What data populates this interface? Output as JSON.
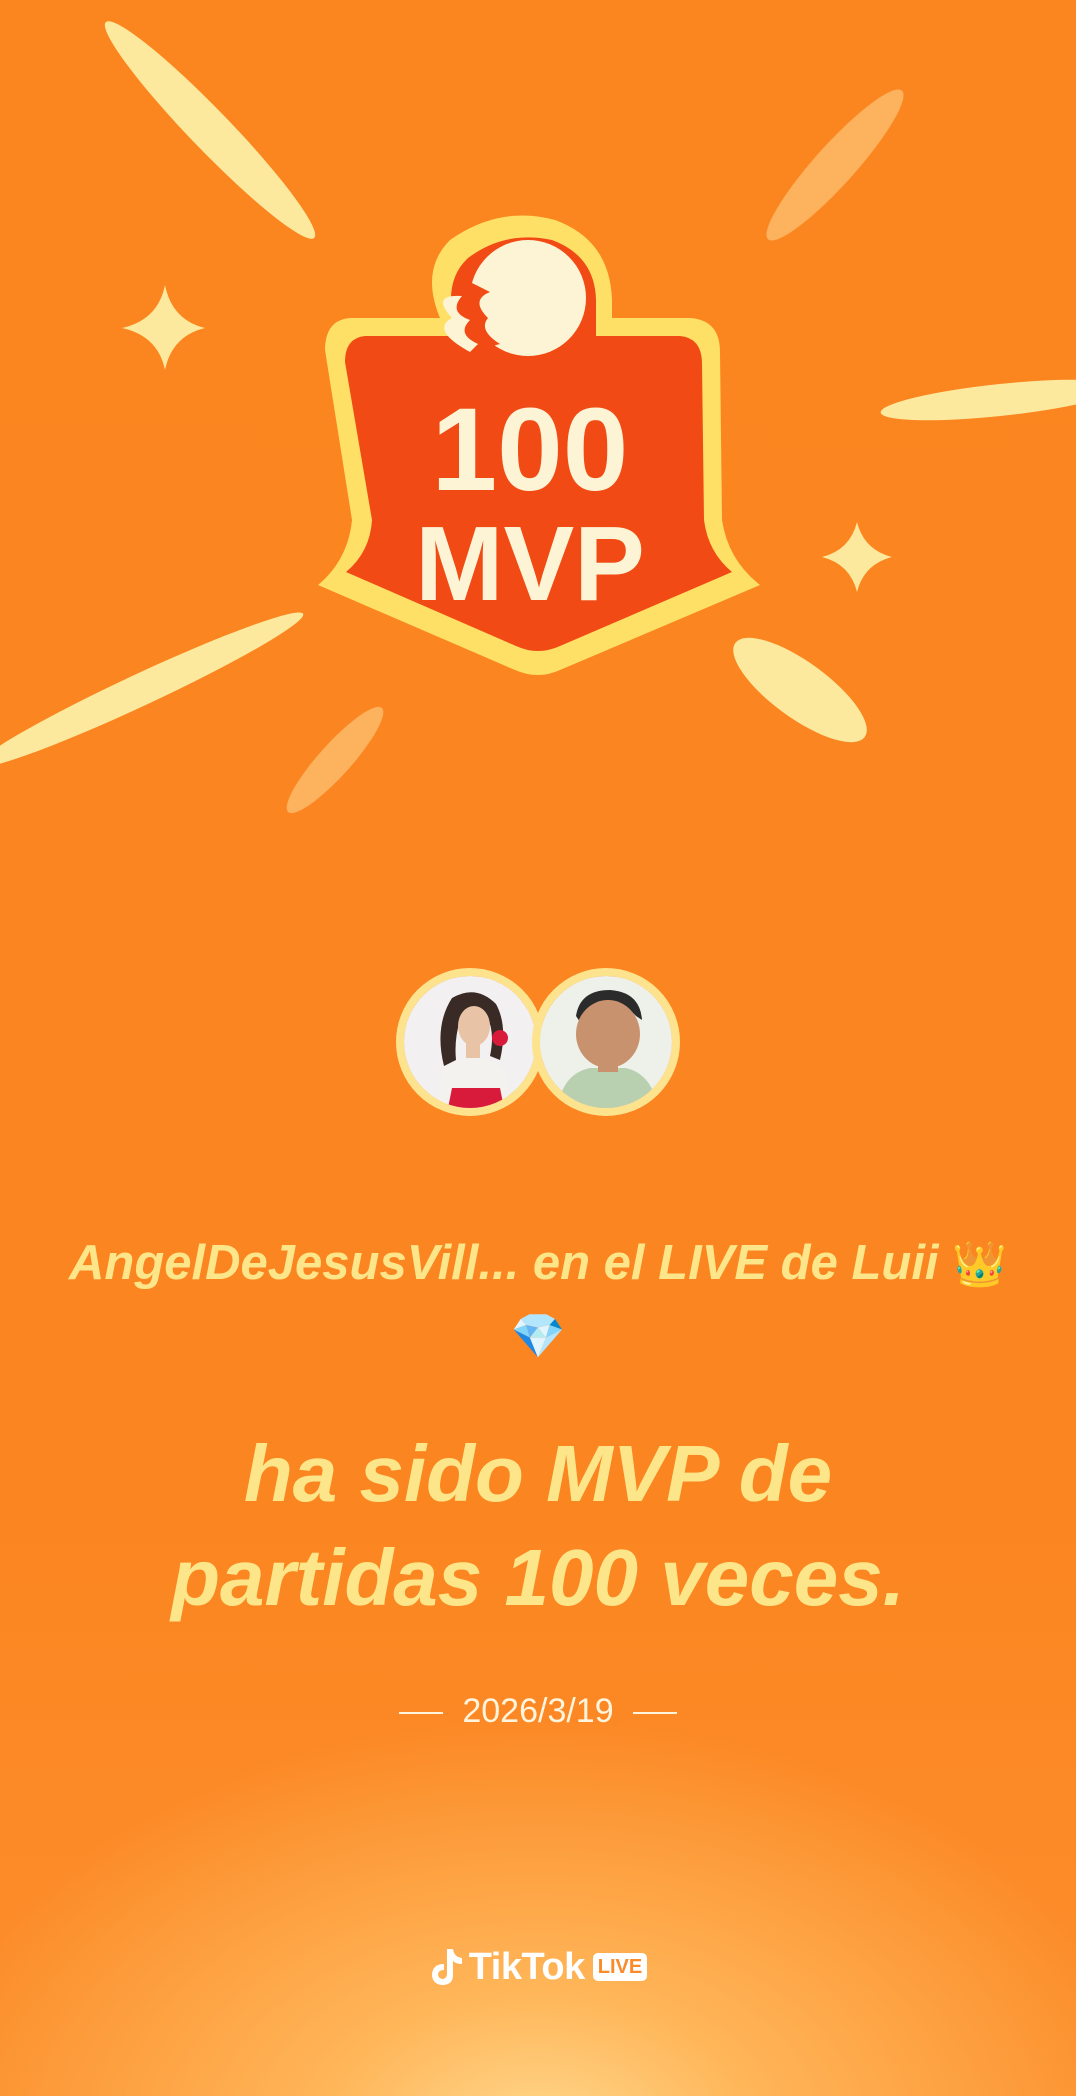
{
  "badge": {
    "line1": "100",
    "line2": "MVP"
  },
  "avatars": {
    "first": "avatar-woman",
    "second": "avatar-man"
  },
  "host_line": {
    "text": "AngelDeJesusVill... en el LIVE de Luii",
    "emojis": "👑💎"
  },
  "headline": {
    "line1": "ha sido MVP de",
    "line2": "partidas 100 veces."
  },
  "date": "2026/3/19",
  "brand": {
    "icon": "tiktok-note-icon",
    "wordmark": "TikTok",
    "live_tag": "LIVE"
  },
  "colors": {
    "background": "#fb8520",
    "text_highlight": "#fde68a",
    "badge_red": "#f24a14",
    "badge_yellow": "#ffd84a"
  }
}
